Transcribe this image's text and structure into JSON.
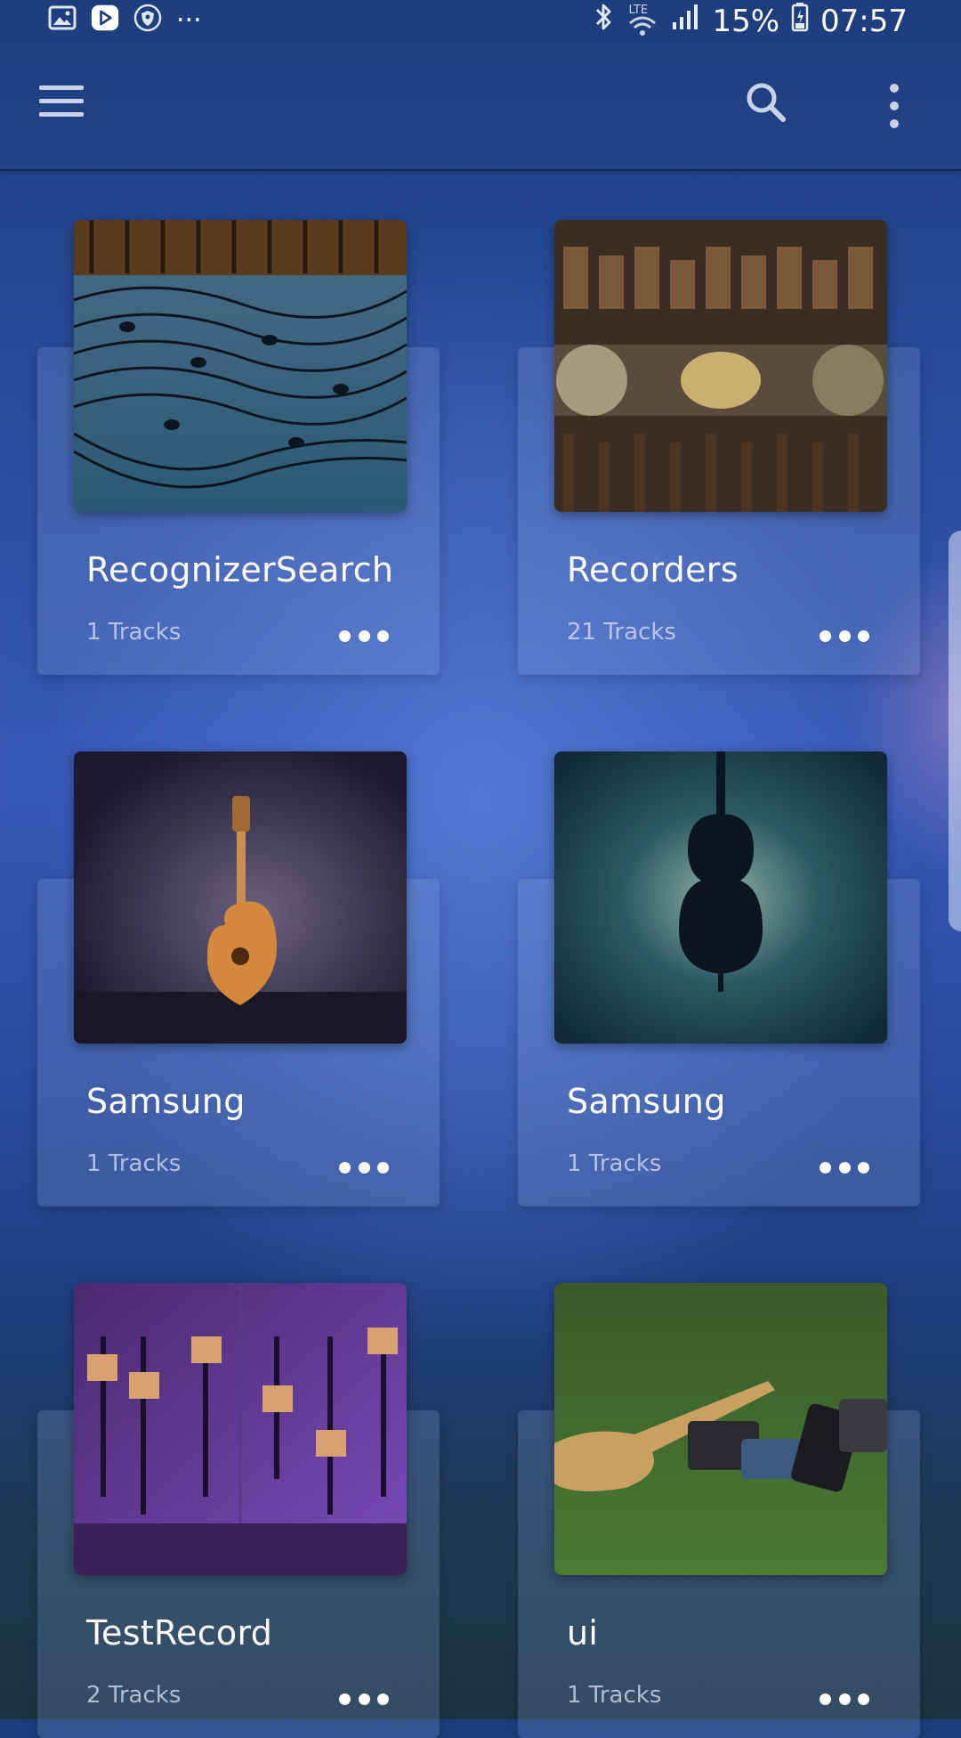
{
  "status_bar": {
    "battery": "15%",
    "time": "07:57",
    "network": "LTE",
    "more": "...",
    "icons": [
      "gallery-icon",
      "play-store-icon",
      "shield-icon",
      "bluetooth-icon",
      "wifi-icon",
      "signal-icon",
      "battery-icon"
    ]
  },
  "app_bar": {
    "icons": [
      "menu-icon",
      "search-icon",
      "more-vert-icon"
    ]
  },
  "playlists": [
    {
      "title": "RecognizerSearch",
      "tracks": "1 Tracks",
      "art": "music-notes-wave-art"
    },
    {
      "title": "Recorders",
      "tracks": "21 Tracks",
      "art": "piano-hammers-art"
    },
    {
      "title": "Samsung",
      "tracks": "1 Tracks",
      "art": "electric-guitar-spotlight-art"
    },
    {
      "title": "Samsung",
      "tracks": "1 Tracks",
      "art": "cello-silhouette-art"
    },
    {
      "title": "TestRecord",
      "tracks": "2 Tracks",
      "art": "mixing-console-art"
    },
    {
      "title": "ui",
      "tracks": "1 Tracks",
      "art": "guitar-pedals-grass-art"
    }
  ],
  "colors": {
    "background_top": "#1d3d7c",
    "background_mid": "#3558b5",
    "card_fill": "rgba(145,170,220,0.22)",
    "text_primary": "#ffffff",
    "text_secondary": "#d7e1f5"
  }
}
